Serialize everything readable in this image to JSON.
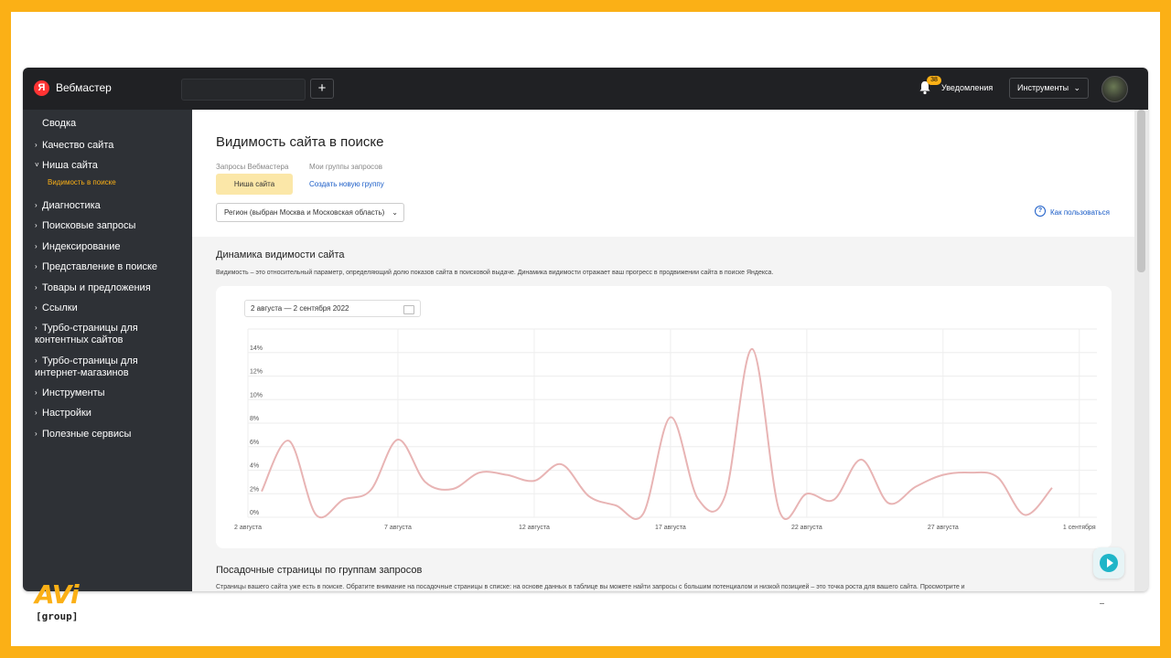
{
  "topbar": {
    "logo_letter": "Я",
    "brand": "Вебмастер",
    "add_label": "+",
    "notifications_badge": "38",
    "notifications_label": "Уведомления",
    "tools_label": "Инструменты",
    "tools_chevron": "⌄"
  },
  "sidebar": {
    "items": [
      {
        "label": "Сводка",
        "bullet": ""
      },
      {
        "label": "Качество сайта",
        "bullet": "›"
      },
      {
        "label": "Ниша сайта",
        "bullet": "˅"
      },
      {
        "label": "Диагностика",
        "bullet": "›"
      },
      {
        "label": "Поисковые запросы",
        "bullet": "›"
      },
      {
        "label": "Индексирование",
        "bullet": "›"
      },
      {
        "label": "Представление в поиске",
        "bullet": "›"
      },
      {
        "label": "Товары и предложения",
        "bullet": "›"
      },
      {
        "label": "Ссылки",
        "bullet": "›"
      },
      {
        "label": "Турбо-страницы для контентных сайтов",
        "bullet": "›"
      },
      {
        "label": "Турбо-страницы для интернет-магазинов",
        "bullet": "›"
      },
      {
        "label": "Инструменты",
        "bullet": "›"
      },
      {
        "label": "Настройки",
        "bullet": "›"
      },
      {
        "label": "Полезные сервисы",
        "bullet": "›"
      }
    ],
    "sub_item": "Видимость в поиске"
  },
  "main": {
    "title": "Видимость сайта в поиске",
    "tab_webmaster": "Запросы Вебмастера",
    "tab_groups": "Мои группы запросов",
    "niche_button": "Ниша сайта",
    "create_group_link": "Создать новую группу",
    "region_select": "Регион (выбран Москва и Московская область)",
    "region_chevron": "⌄",
    "help_icon": "?",
    "help_link": "Как пользоваться",
    "dynamics_title": "Динамика видимости сайта",
    "dynamics_desc": "Видимость – это относительный параметр, определяющий долю показов сайта в поисковой выдаче. Динамика видимости отражает ваш прогресс в продвижении сайта в поиске Яндекса.",
    "date_range": "2 августа — 2 сентября 2022",
    "landing_title": "Посадочные страницы по группам запросов",
    "landing_desc": "Страницы вашего сайта уже есть в поиске. Обратите внимание на посадочные страницы в списке: на основе данных в таблице вы можете найти запросы с большим потенциалом и низкой позицией – это точка роста для вашего сайта. Просмотрите и"
  },
  "colors": {
    "frame": "#fbb016",
    "line": "#e8b4b4",
    "topbar": "#202124",
    "sidebar": "#2e3136",
    "link": "#1a5cc7"
  },
  "icons": {
    "bell": "bell-icon",
    "calendar": "calendar-icon",
    "help": "help-circle-icon",
    "fab": "chat-assistant-icon"
  },
  "chart_data": {
    "type": "line",
    "x": [
      "2022-08-02",
      "2022-08-03",
      "2022-08-04",
      "2022-08-05",
      "2022-08-06",
      "2022-08-07",
      "2022-08-08",
      "2022-08-09",
      "2022-08-10",
      "2022-08-11",
      "2022-08-12",
      "2022-08-13",
      "2022-08-14",
      "2022-08-15",
      "2022-08-16",
      "2022-08-17",
      "2022-08-18",
      "2022-08-19",
      "2022-08-20",
      "2022-08-21",
      "2022-08-22",
      "2022-08-23",
      "2022-08-24",
      "2022-08-25",
      "2022-08-26",
      "2022-08-27",
      "2022-08-28",
      "2022-08-29",
      "2022-08-30",
      "2022-08-31"
    ],
    "xtick_labels": [
      "2 августа",
      "7 августа",
      "12 августа",
      "17 августа",
      "22 августа",
      "27 августа",
      "1 сентября"
    ],
    "ytick_labels": [
      "0%",
      "2%",
      "4%",
      "6%",
      "8%",
      "10%",
      "12%",
      "14%"
    ],
    "series": [
      {
        "values": [
          2.2,
          6.5,
          0.2,
          1.5,
          2.3,
          6.6,
          3.0,
          2.4,
          3.8,
          3.6,
          3.1,
          4.5,
          1.8,
          1.0,
          0.3,
          8.5,
          1.6,
          1.8,
          14.3,
          0.5,
          2.0,
          1.5,
          4.9,
          1.2,
          2.6,
          3.6,
          3.8,
          3.4,
          0.2,
          2.5
        ]
      }
    ],
    "ylim": [
      0,
      16
    ],
    "grid": true,
    "legend": "none"
  },
  "branding": {
    "avi": "AVi",
    "group": "[group]"
  }
}
